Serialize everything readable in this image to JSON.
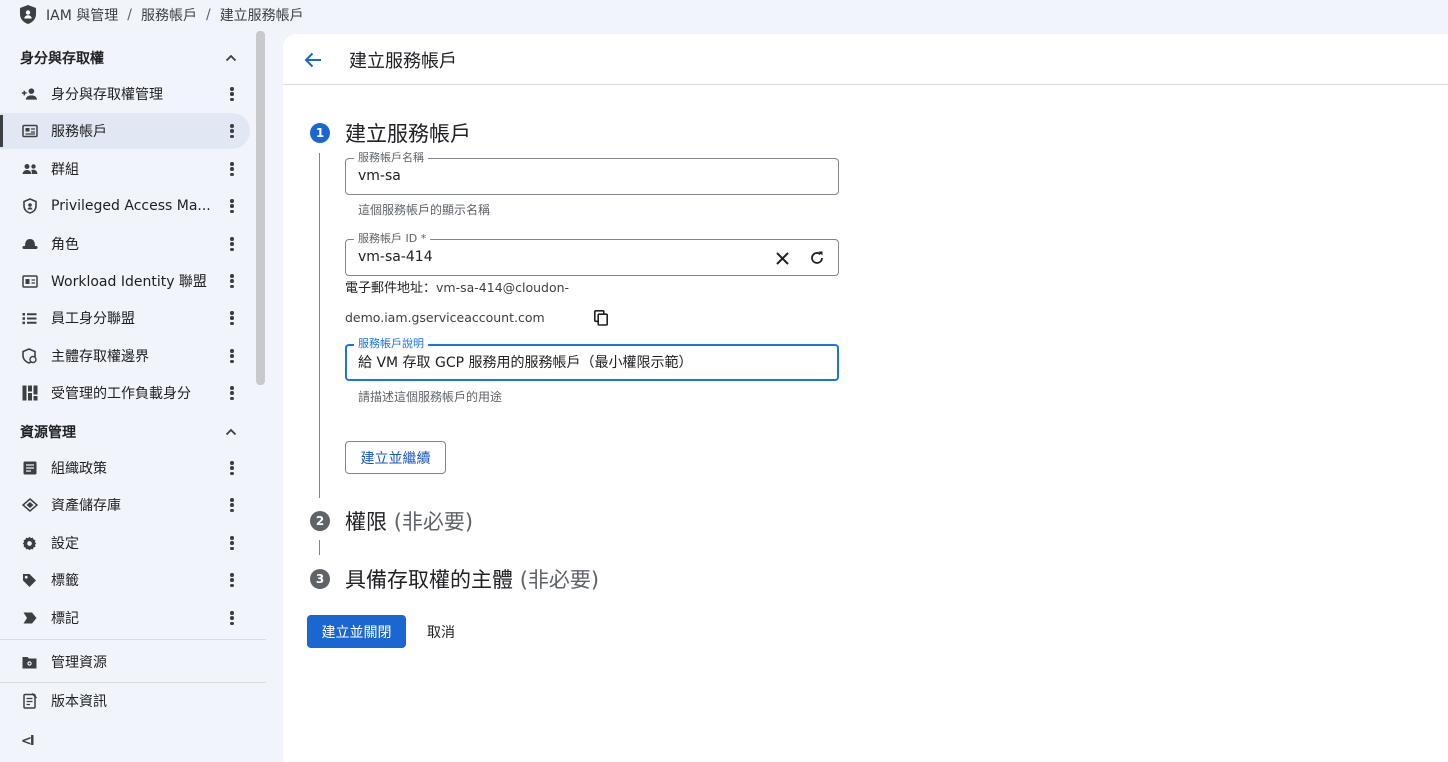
{
  "breadcrumb": {
    "items": [
      "IAM 與管理",
      "服務帳戶",
      "建立服務帳戶"
    ],
    "separator": "/"
  },
  "sidebar": {
    "sections": [
      {
        "title": "身分與存取權",
        "items": [
          {
            "label": "身分與存取權管理",
            "icon": "person-add-icon"
          },
          {
            "label": "服務帳戶",
            "icon": "service-account-icon",
            "active": true
          },
          {
            "label": "群組",
            "icon": "group-icon"
          },
          {
            "label": "Privileged Access Ma...",
            "icon": "shield-icon"
          },
          {
            "label": "角色",
            "icon": "hat-icon"
          },
          {
            "label": "Workload Identity 聯盟",
            "icon": "id-card-icon"
          },
          {
            "label": "員工身分聯盟",
            "icon": "list-icon"
          },
          {
            "label": "主體存取權邊界",
            "icon": "boundary-icon"
          },
          {
            "label": "受管理的工作負載身分",
            "icon": "workload-icon"
          }
        ]
      },
      {
        "title": "資源管理",
        "items": [
          {
            "label": "組織政策",
            "icon": "policy-icon"
          },
          {
            "label": "資產儲存庫",
            "icon": "asset-icon"
          },
          {
            "label": "設定",
            "icon": "gear-icon"
          },
          {
            "label": "標籤",
            "icon": "tag-icon"
          },
          {
            "label": "標記",
            "icon": "label-icon"
          }
        ]
      }
    ],
    "footer_items": [
      {
        "label": "管理資源",
        "icon": "manage-resources-icon"
      },
      {
        "label": "版本資訊",
        "icon": "release-notes-icon"
      }
    ],
    "collapse_glyph": "<I"
  },
  "main": {
    "title": "建立服務帳戶",
    "steps": [
      {
        "number": "1",
        "title": "建立服務帳戶",
        "optional": ""
      },
      {
        "number": "2",
        "title": "權限",
        "optional": "(非必要)"
      },
      {
        "number": "3",
        "title": "具備存取權的主體",
        "optional": "(非必要)"
      }
    ],
    "form": {
      "name": {
        "label": "服務帳戶名稱",
        "value": "vm-sa",
        "hint": "這個服務帳戶的顯示名稱"
      },
      "id": {
        "label": "服務帳戶 ID *",
        "value": "vm-sa-414"
      },
      "email": {
        "prefix": "電子郵件地址：",
        "line1": "vm-sa-414@cloudon-",
        "line2": "demo.iam.gserviceaccount.com"
      },
      "description": {
        "label": "服務帳戶說明",
        "value": "給 VM 存取 GCP 服務用的服務帳戶（最小權限示範）",
        "hint": "請描述這個服務帳戶的用途"
      }
    },
    "buttons": {
      "create_continue": "建立並繼續",
      "create_close": "建立並關閉",
      "cancel": "取消"
    }
  },
  "colors": {
    "accent": "#1a73e8",
    "primary_button": "#1a67d2",
    "step_active": "#1a67d2",
    "step_inactive": "#5f6368",
    "sidebar_bg": "#f1f4fb",
    "active_item_bg": "#e2e7f4"
  }
}
